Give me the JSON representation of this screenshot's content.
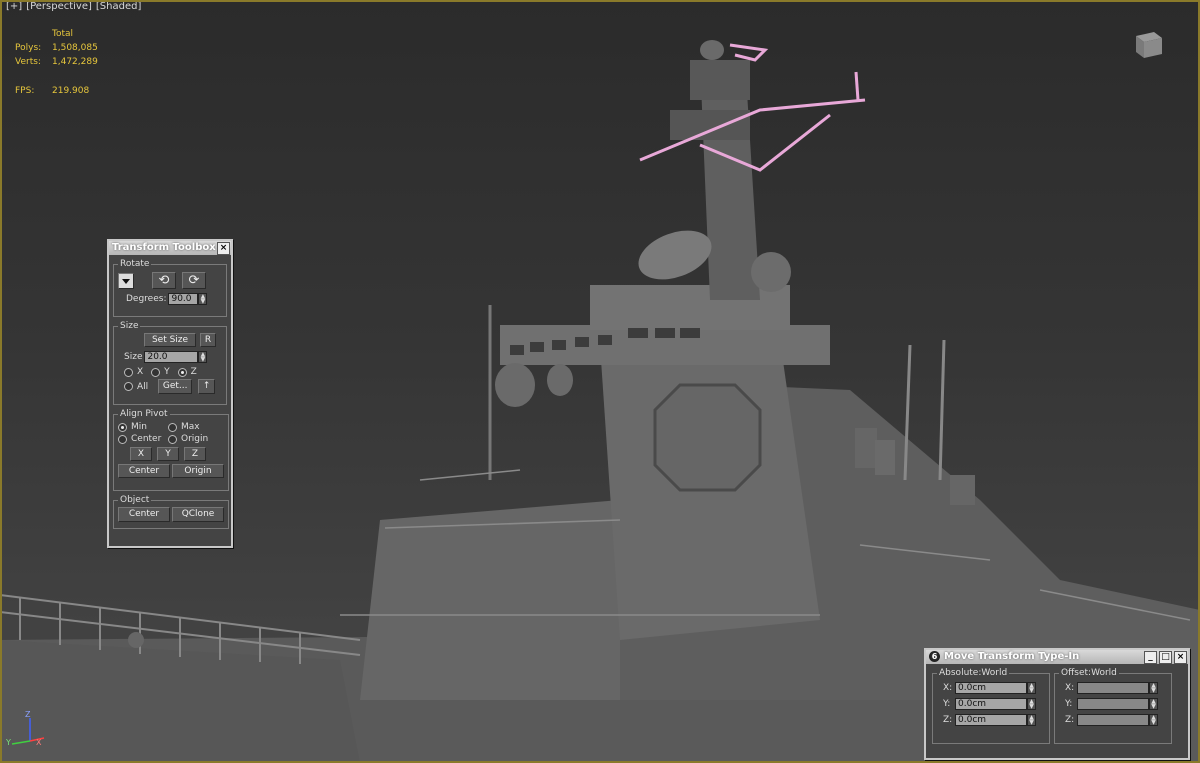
{
  "viewport": {
    "label_plus": "[+]",
    "label_view": "[Perspective]",
    "label_shading": "[Shaded]",
    "stats": {
      "header": "Total",
      "polys_label": "Polys:",
      "polys_value": "1,508,085",
      "verts_label": "Verts:",
      "verts_value": "1,472,289",
      "fps_label": "FPS:",
      "fps_value": "219.908"
    },
    "axis": {
      "x": "X",
      "y": "Y",
      "z": "Z"
    },
    "colors": {
      "border": "#8a7a2a",
      "stats": "#e6c63c",
      "selection": "#e8a8d8",
      "ship": "#6e6e6e"
    }
  },
  "transform_toolbox": {
    "title": "Transform Toolbox",
    "close": "×",
    "rotate": {
      "legend": "Rotate",
      "degrees_label": "Degrees:",
      "degrees_value": "90.0",
      "ccw_icon": "rotate-ccw-icon",
      "cw_icon": "rotate-cw-icon"
    },
    "size": {
      "legend": "Size",
      "set_size": "Set Size",
      "r": "R",
      "size_label": "Size",
      "size_value": "20.0",
      "x": "X",
      "y": "Y",
      "z": "Z",
      "all": "All",
      "selected_axis": "Z",
      "get": "Get...",
      "up_icon": "↑"
    },
    "align_pivot": {
      "legend": "Align Pivot",
      "min": "Min",
      "max": "Max",
      "center": "Center",
      "origin": "Origin",
      "selected": "Min",
      "x": "X",
      "y": "Y",
      "z": "Z",
      "center_btn": "Center",
      "origin_btn": "Origin"
    },
    "object": {
      "legend": "Object",
      "center": "Center",
      "qclone": "QClone"
    }
  },
  "move_typein": {
    "title": "Move Transform Type-In",
    "icon": "6",
    "min": "_",
    "max": "□",
    "close": "×",
    "absolute": {
      "legend": "Absolute:World",
      "x_label": "X:",
      "x_value": "0.0cm",
      "y_label": "Y:",
      "y_value": "0.0cm",
      "z_label": "Z:",
      "z_value": "0.0cm"
    },
    "offset": {
      "legend": "Offset:World",
      "x_label": "X:",
      "x_value": "",
      "y_label": "Y:",
      "y_value": "",
      "z_label": "Z:",
      "z_value": ""
    }
  }
}
